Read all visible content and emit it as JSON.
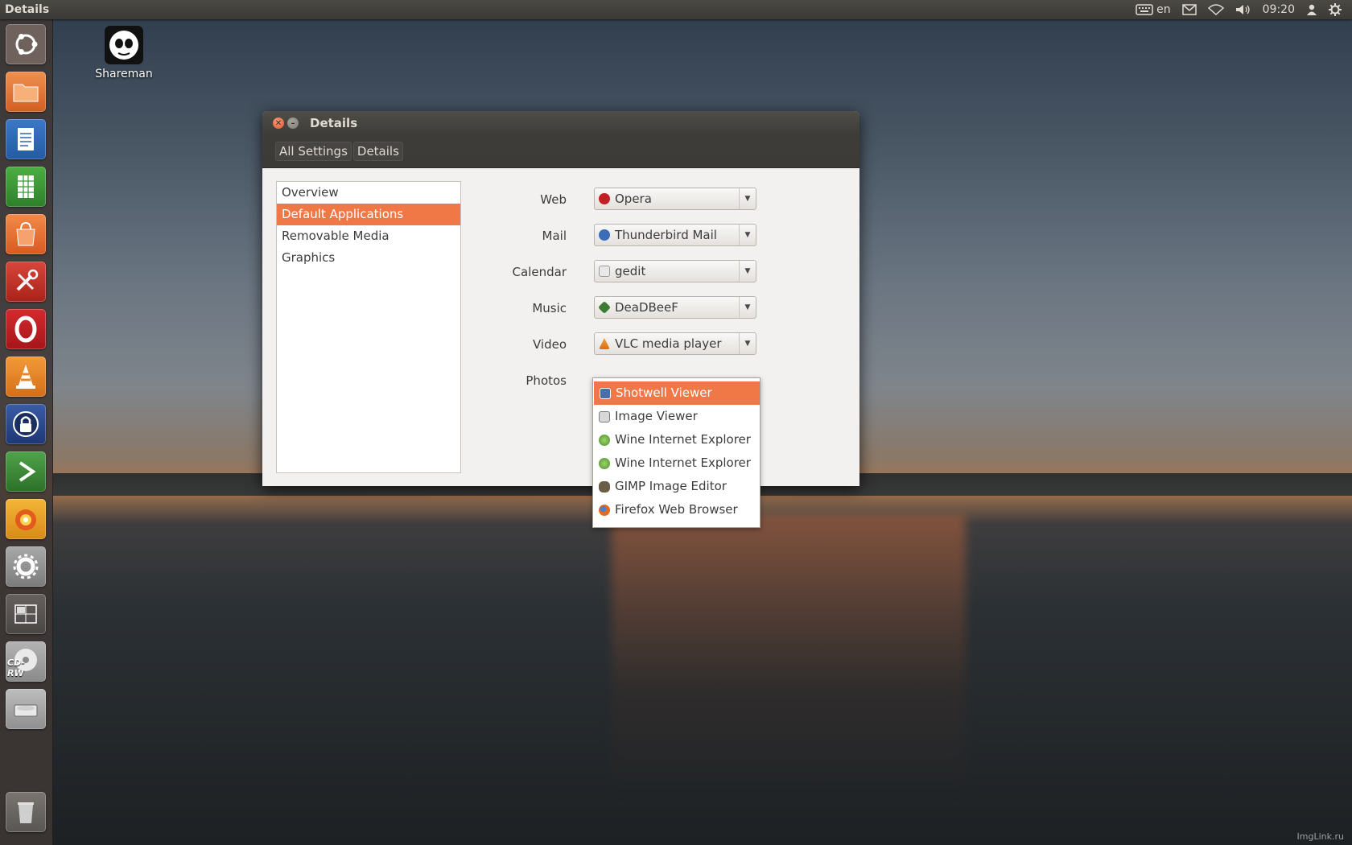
{
  "top_panel": {
    "title": "Details",
    "keyboard_layout": "en",
    "clock": "09:20",
    "icons": [
      "keyboard-icon",
      "mail-icon",
      "wifi-icon",
      "volume-icon",
      "user-icon",
      "gear-icon"
    ]
  },
  "desktop": {
    "icon_label": "Shareman",
    "watermark": "ImgLink.ru"
  },
  "launcher": {
    "items": [
      {
        "name": "dash-home",
        "icon": "ubuntu-logo-icon",
        "color": "#7a6a62"
      },
      {
        "name": "files",
        "icon": "folder-icon",
        "color": "#e07a3a"
      },
      {
        "name": "libreoffice-writer",
        "icon": "document-icon",
        "color": "#2f66b3"
      },
      {
        "name": "libreoffice-calc",
        "icon": "spreadsheet-icon",
        "color": "#3f9a3a"
      },
      {
        "name": "software-center",
        "icon": "shopping-bag-icon",
        "color": "#e86f2c"
      },
      {
        "name": "system-tools",
        "icon": "tools-icon",
        "color": "#c9362b"
      },
      {
        "name": "opera",
        "icon": "opera-icon",
        "color": "#c01f24"
      },
      {
        "name": "vlc",
        "icon": "vlc-cone-icon",
        "color": "#e8862a"
      },
      {
        "name": "keepass",
        "icon": "lock-icon",
        "color": "#2b4a8c"
      },
      {
        "name": "deadbeef",
        "icon": "play-icon",
        "color": "#3d8d3a"
      },
      {
        "name": "burner",
        "icon": "disc-flame-icon",
        "color": "#e4a72b"
      },
      {
        "name": "system-settings",
        "icon": "gear-icon",
        "color": "#8b8b8b"
      },
      {
        "name": "workspace-switcher",
        "icon": "workspaces-icon",
        "color": "#5a5654"
      },
      {
        "name": "cd-rw",
        "icon": "cd-icon",
        "color": "#8b8b8b"
      },
      {
        "name": "hard-drive",
        "icon": "drive-icon",
        "color": "#8b8b8b"
      },
      {
        "name": "trash",
        "icon": "trash-icon",
        "color": "#6e6a66"
      }
    ],
    "cd_label": "CD-RW"
  },
  "window": {
    "title": "Details",
    "breadcrumbs": [
      "All Settings",
      "Details"
    ],
    "sidebar": [
      "Overview",
      "Default Applications",
      "Removable Media",
      "Graphics"
    ],
    "selected_sidebar": "Default Applications",
    "rows": [
      {
        "label": "Web",
        "value": "Opera",
        "icon": "opera-icon",
        "icon_color": "#c01f24"
      },
      {
        "label": "Mail",
        "value": "Thunderbird Mail",
        "icon": "thunderbird-icon",
        "icon_color": "#3a6db5"
      },
      {
        "label": "Calendar",
        "value": "gedit",
        "icon": "gedit-icon",
        "icon_color": "#9a9a9a"
      },
      {
        "label": "Music",
        "value": "DeaDBeeF",
        "icon": "deadbeef-icon",
        "icon_color": "#3d7a35"
      },
      {
        "label": "Video",
        "value": "VLC media player",
        "icon": "vlc-cone-icon",
        "icon_color": "#e8862a"
      },
      {
        "label": "Photos",
        "value": "Shotwell Viewer",
        "icon": "shotwell-icon",
        "icon_color": "#4a6fa8"
      }
    ]
  },
  "photos_dropdown": {
    "options": [
      {
        "label": "Shotwell Viewer",
        "icon": "shotwell-icon",
        "icon_color": "#4a6fa8",
        "selected": true
      },
      {
        "label": "Image Viewer",
        "icon": "image-viewer-icon",
        "icon_color": "#7b7b7b"
      },
      {
        "label": "Wine Internet Explorer",
        "icon": "wine-ie-icon",
        "icon_color": "#5aa037"
      },
      {
        "label": "Wine Internet Explorer",
        "icon": "wine-ie-icon",
        "icon_color": "#5aa037"
      },
      {
        "label": "GIMP Image Editor",
        "icon": "gimp-icon",
        "icon_color": "#5a4f3c"
      },
      {
        "label": "Firefox Web Browser",
        "icon": "firefox-icon",
        "icon_color": "#e06a1f"
      }
    ]
  },
  "colors": {
    "accent": "#f07746",
    "panel": "#3c3b37"
  }
}
